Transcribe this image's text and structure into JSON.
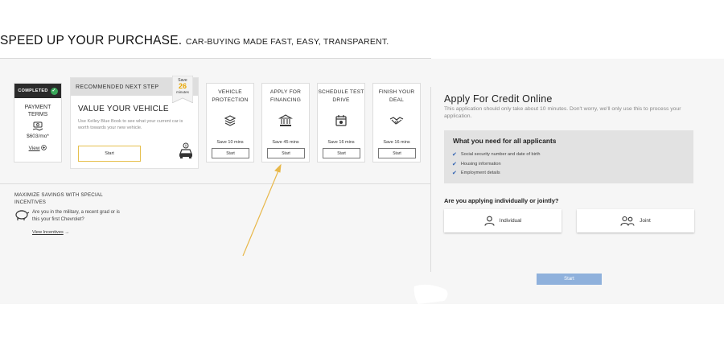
{
  "header": {
    "headline_main": "SPEED UP YOUR PURCHASE.",
    "headline_sub": "CAR-BUYING MADE FAST, EASY, TRANSPARENT."
  },
  "completed_card": {
    "badge": "COMPLETED",
    "title": "PAYMENT TERMS",
    "value": "$603/mo*",
    "view_label": "View",
    "view_icon": "circle-plus-icon"
  },
  "recommended_card": {
    "header": "RECOMMENDED NEXT STEP",
    "title": "VALUE YOUR VEHICLE",
    "description": "Use Kelley Blue Book to see what your current car is worth towards your new vehicle.",
    "button": "Start",
    "icon": "car-value-icon",
    "ribbon": {
      "top": "Save",
      "number": "26",
      "bottom": "minutes"
    }
  },
  "steps": [
    {
      "title": "VEHICLE PROTECTION",
      "save": "Save 10 mins",
      "button": "Start",
      "icon": "shield-stack-icon"
    },
    {
      "title": "APPLY FOR FINANCING",
      "save": "Save 45 mins",
      "button": "Start",
      "icon": "bank-icon"
    },
    {
      "title": "SCHEDULE TEST DRIVE",
      "save": "Save 16 mins",
      "button": "Start",
      "icon": "calendar-icon"
    },
    {
      "title": "FINISH YOUR DEAL",
      "save": "Save 16 mins",
      "button": "Start",
      "icon": "handshake-icon"
    }
  ],
  "incentives": {
    "heading": "MAXIMIZE SAVINGS WITH SPECIAL INCENTIVES",
    "text": "Are you in the military, a recent grad or is this your first Chevrolet?",
    "link": "View Incentives",
    "icon": "piggy-bank-icon"
  },
  "credit": {
    "title": "Apply For Credit Online",
    "description": "This application should only take about 10 minutes. Don't worry, we'll only use this to process your application.",
    "needs_title": "What you need for all applicants",
    "needs": [
      "Social security number and date of birth",
      "Housing information",
      "Employment details"
    ],
    "question": "Are you applying individually or jointly?",
    "options": [
      {
        "label": "Individual",
        "icon": "person-icon"
      },
      {
        "label": "Joint",
        "icon": "two-people-icon"
      }
    ],
    "start_button": "Start"
  },
  "colors": {
    "accent_yellow": "#e8a600",
    "check_green": "#3aa85a",
    "link_blue": "#2a5db0",
    "start_disabled_blue": "#8fb1dc",
    "annotation_arrow": "#e8b84a"
  }
}
